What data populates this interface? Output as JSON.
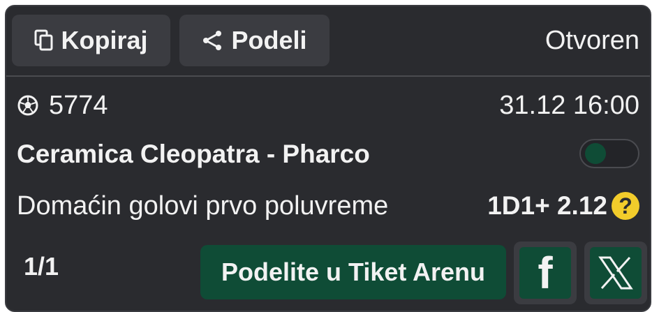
{
  "toolbar": {
    "copy_label": "Kopiraj",
    "share_label": "Podeli",
    "status": "Otvoren"
  },
  "event": {
    "sport_icon": "soccer-ball-icon",
    "id": "5774",
    "datetime": "31.12 16:00",
    "match": "Ceramica Cleopatra - Pharco",
    "market": "Domaćin golovi prvo poluvreme",
    "odds": "1D1+ 2.12",
    "help_icon": "?"
  },
  "footer": {
    "count": "1/1",
    "arena_label": "Podelite u Tiket Arenu",
    "facebook_glyph": "f"
  },
  "colors": {
    "card_bg": "#2a2b2f",
    "button_bg": "#3b3c41",
    "accent_green": "#0f4c36",
    "help_yellow": "#f2cc2b"
  }
}
